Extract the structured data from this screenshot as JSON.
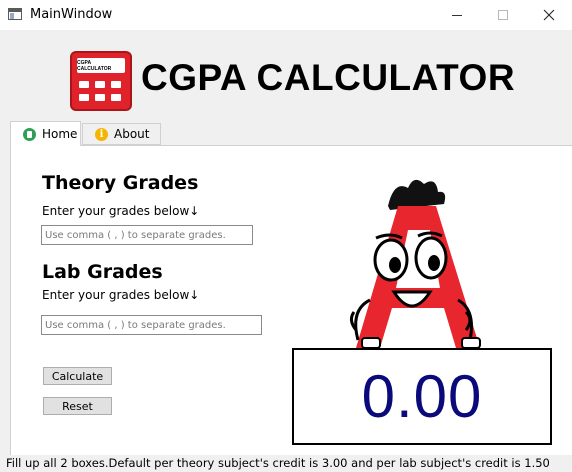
{
  "window": {
    "title": "MainWindow"
  },
  "header": {
    "logo_text": "CGPA CALCULATOR",
    "heading": "CGPA CALCULATOR"
  },
  "tabs": [
    {
      "label": "Home",
      "icon": "calculator-icon",
      "active": true
    },
    {
      "label": "About",
      "icon": "info-icon",
      "active": false
    }
  ],
  "theory": {
    "heading": "Theory Grades",
    "hint": "Enter your grades below↓",
    "value": "",
    "placeholder": "Use comma ( , ) to separate grades."
  },
  "lab": {
    "heading": "Lab Grades",
    "hint": "Enter your grades below↓",
    "value": "",
    "placeholder": "Use comma ( , ) to separate grades."
  },
  "buttons": {
    "calculate": "Calculate",
    "reset": "Reset"
  },
  "result": {
    "value": "0.00"
  },
  "status": {
    "message": "Fill up all 2 boxes.Default per theory subject's credit is 3.00 and per lab subject's credit is 1.50"
  },
  "colors": {
    "accent_red": "#e0232a",
    "result_text": "#0a0a7a",
    "mascot_red": "#e8262d"
  }
}
